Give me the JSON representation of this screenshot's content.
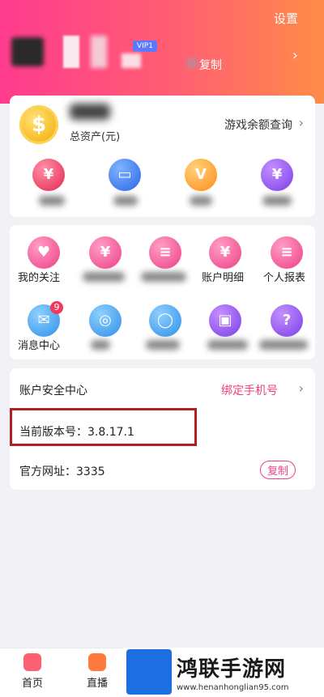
{
  "header": {
    "settings_label": "设置",
    "vip_label": "VIP1",
    "copy_label": "复制"
  },
  "assets": {
    "total_label": "总资产(元)",
    "game_balance_label": "游戏余额查询",
    "coin_symbol": "$"
  },
  "services": [
    {
      "label": "我的关注",
      "icon": "heart-plus-icon"
    },
    {
      "label": "",
      "icon": "card-icon"
    },
    {
      "label": "",
      "icon": "record-icon"
    },
    {
      "label": "账户明细",
      "icon": "account-detail-icon"
    },
    {
      "label": "个人报表",
      "icon": "report-icon"
    },
    {
      "label": "消息中心",
      "icon": "message-icon"
    },
    {
      "label": "",
      "icon": "chip-icon"
    },
    {
      "label": "",
      "icon": "headset-icon"
    },
    {
      "label": "",
      "icon": "id-card-icon"
    },
    {
      "label": "",
      "icon": "help-icon"
    }
  ],
  "message_badge": "9",
  "security": {
    "title": "账户安全中心",
    "bind_phone": "绑定手机号",
    "version": "当前版本号：3.8.17.1",
    "website_label": "官方网址：3335",
    "copy_button": "复制"
  },
  "bottom_nav": {
    "home": "首页",
    "live": "直播"
  },
  "watermark": {
    "title": "鸿联手游网",
    "url": "www.henanhonglian95.com"
  },
  "colors": {
    "header_start": "#ff3b8e",
    "header_end": "#ff8c47",
    "accent_pink": "#ee3f86",
    "highlight_box": "#b21f24"
  }
}
